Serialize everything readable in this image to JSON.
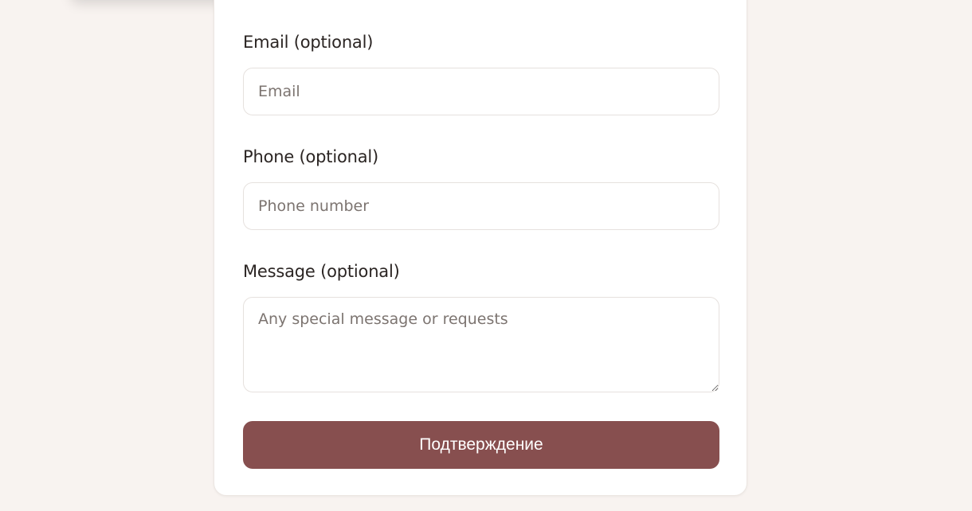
{
  "form": {
    "email": {
      "label": "Email (optional)",
      "placeholder": "Email",
      "value": ""
    },
    "phone": {
      "label": "Phone (optional)",
      "placeholder": "Phone number",
      "value": ""
    },
    "message": {
      "label": "Message (optional)",
      "placeholder": "Any special message or requests",
      "value": ""
    },
    "submit_label": "Подтверждение"
  },
  "colors": {
    "page_background": "#f8f3f0",
    "card_background": "#ffffff",
    "button_background": "#874f4f",
    "button_text": "#ffffff",
    "label_text": "#2b2523",
    "placeholder_text": "#7c7470"
  }
}
